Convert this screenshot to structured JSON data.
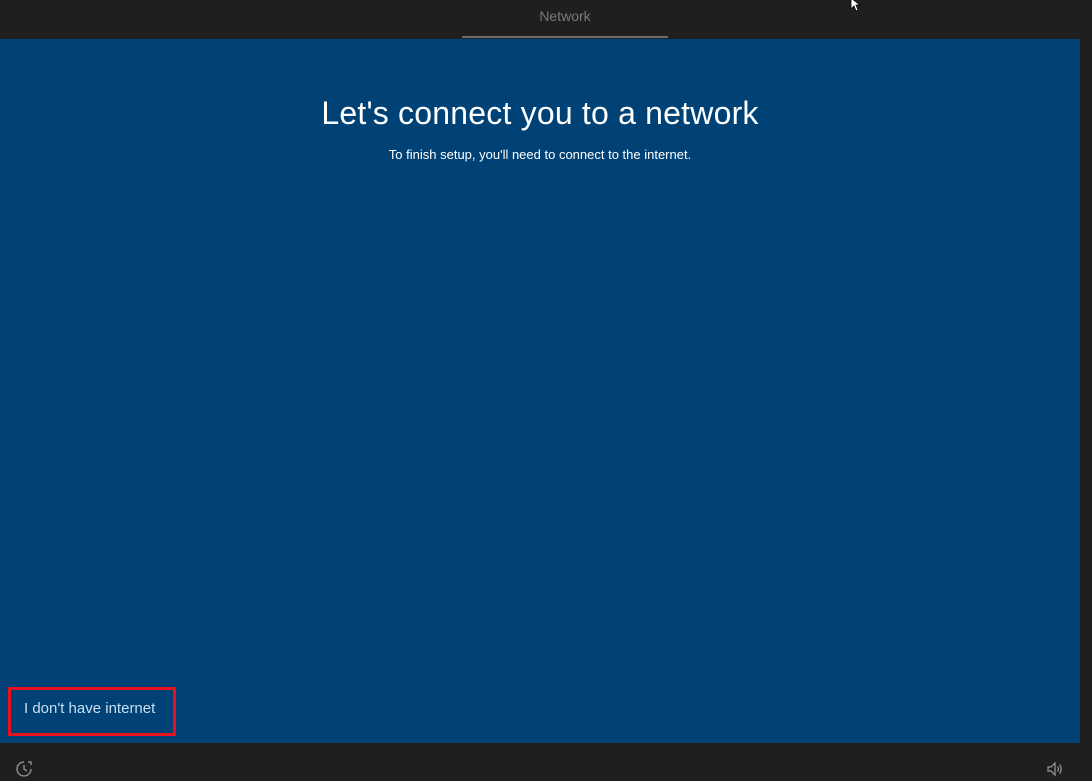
{
  "header": {
    "step_label": "Network"
  },
  "main": {
    "title": "Let's connect you to a network",
    "subtitle": "To finish setup, you'll need to connect to the internet.",
    "no_internet_link": "I don't have internet"
  },
  "footer": {
    "left_icon": "ease-of-access-icon",
    "right_icon": "volume-icon"
  },
  "colors": {
    "panel_background": "#004275",
    "chrome_background": "#1f1f1f",
    "highlight_border": "#e8101f",
    "link_text": "#c9dff2"
  }
}
